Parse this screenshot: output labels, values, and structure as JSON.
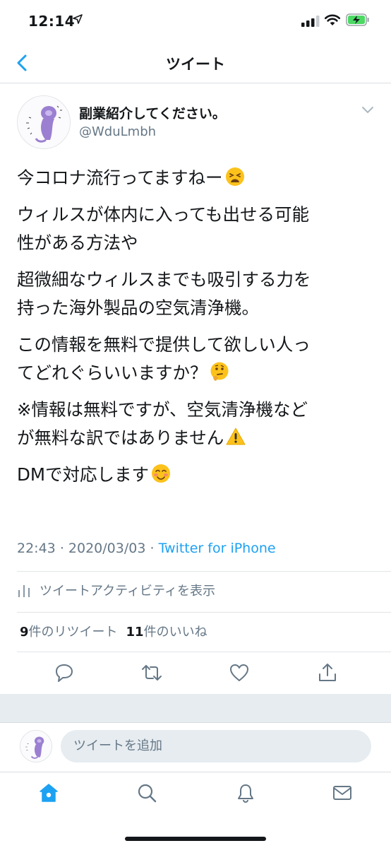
{
  "status_bar": {
    "time": "12:14"
  },
  "nav": {
    "title": "ツイート"
  },
  "tweet": {
    "display_name": "副業紹介してください。",
    "handle": "@WduLmbh",
    "paragraphs": [
      {
        "text": "今コロナ流行ってますねー",
        "emoji": "tired-face-emoji"
      },
      {
        "text": "ウィルスが体内に入っても出せる可能\n性がある方法や"
      },
      {
        "text": "超微細なウィルスまでも吸引する力を\n持った海外製品の空気清浄機。"
      },
      {
        "text": "この情報を無料で提供して欲しい人っ\nてどれぐらいいますか？",
        "emoji": "thinking-face-emoji"
      },
      {
        "text": "※情報は無料ですが、空気清浄機など\nが無料な訳ではありません",
        "emoji": "warning-emoji"
      },
      {
        "text": "DMで対応します",
        "emoji": "smiling-face-emoji"
      }
    ],
    "time": "22:43",
    "date": "2020/03/03",
    "separator": "·",
    "source": "Twitter for iPhone",
    "activity_label": "ツイートアクティビティを表示",
    "retweet_count": "9",
    "retweet_label": "件のリツイート",
    "like_count": "11",
    "like_label": "件のいいね"
  },
  "reply": {
    "placeholder": "ツイートを追加"
  },
  "colors": {
    "accent": "#1da1f2",
    "secondary_text": "#657786",
    "divider": "#e1e4e6"
  }
}
